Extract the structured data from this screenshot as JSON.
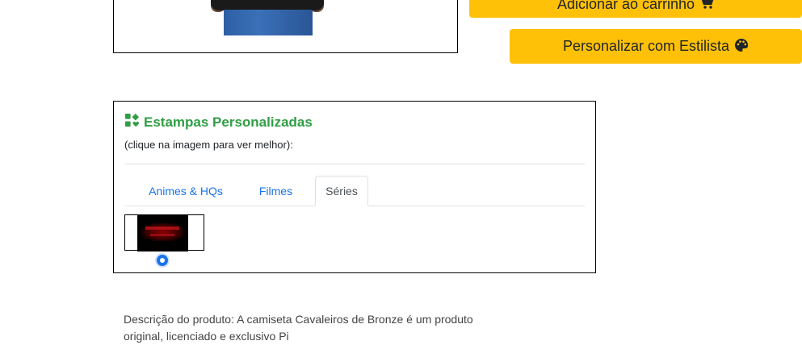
{
  "actions": {
    "add_to_cart_label": "Adicionar ao carrinho",
    "add_to_cart_icon": "shopping-cart-icon",
    "stylist_label": "Personalizar com Estilista",
    "stylist_icon": "palette-icon",
    "button_color": "#ffc107"
  },
  "prints": {
    "title": "Estampas Personalizadas",
    "title_color": "#2f9e44",
    "subtitle": "(clique na imagem para ver melhor):",
    "tabs": [
      {
        "label": "Animes & HQs",
        "active": false
      },
      {
        "label": "Filmes",
        "active": false
      },
      {
        "label": "Séries",
        "active": true
      }
    ],
    "selected_print": "stranger-things-print",
    "radio_checked": true
  },
  "description": {
    "text": "Descrição do produto: A camiseta Cavaleiros de Bronze é um produto original, licenciado e exclusivo Pi"
  }
}
